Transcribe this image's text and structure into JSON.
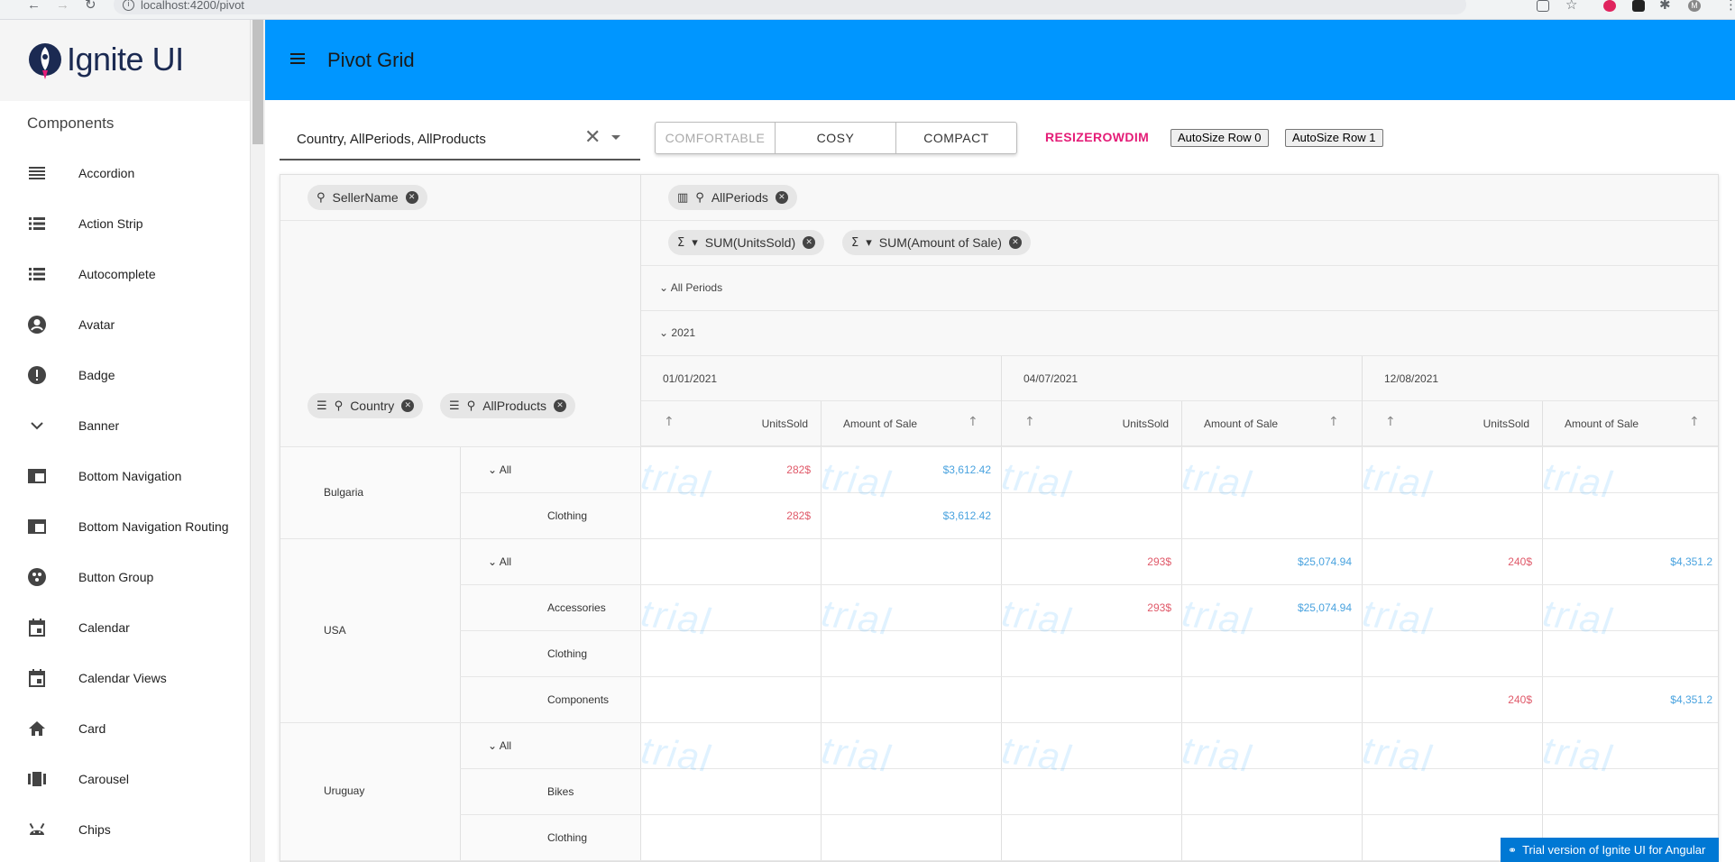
{
  "browser": {
    "url": "localhost:4200/pivot",
    "profile_letter": "M"
  },
  "sidebar": {
    "logo_text": "Ignite UI",
    "heading": "Components",
    "items": [
      {
        "label": "Accordion",
        "icon": "list-icon"
      },
      {
        "label": "Action Strip",
        "icon": "list-icon"
      },
      {
        "label": "Autocomplete",
        "icon": "list-icon"
      },
      {
        "label": "Avatar",
        "icon": "account-circle-icon"
      },
      {
        "label": "Badge",
        "icon": "error-icon"
      },
      {
        "label": "Banner",
        "icon": "chevron-down-icon"
      },
      {
        "label": "Bottom Navigation",
        "icon": "web-icon"
      },
      {
        "label": "Bottom Navigation Routing",
        "icon": "web-icon"
      },
      {
        "label": "Button Group",
        "icon": "group-work-icon"
      },
      {
        "label": "Calendar",
        "icon": "calendar-icon"
      },
      {
        "label": "Calendar Views",
        "icon": "calendar-icon"
      },
      {
        "label": "Card",
        "icon": "home-icon"
      },
      {
        "label": "Carousel",
        "icon": "carousel-icon"
      },
      {
        "label": "Chips",
        "icon": "android-icon"
      }
    ]
  },
  "header": {
    "title": "Pivot Grid"
  },
  "toolbar": {
    "combo_value": "Country, AllPeriods, AllProducts",
    "density": [
      "COMFORTABLE",
      "COSY",
      "COMPACT"
    ],
    "resize_label": "RESIZEROWDIM",
    "autosize0": "AutoSize Row 0",
    "autosize1": "AutoSize Row 1"
  },
  "pivot": {
    "filter_chip": "SellerName",
    "column_chip": "AllPeriods",
    "value_chips": [
      "SUM(UnitsSold)",
      "SUM(Amount of Sale)"
    ],
    "row_chips": [
      "Country",
      "AllProducts"
    ],
    "all_periods": "All Periods",
    "year": "2021",
    "dates": [
      "01/01/2021",
      "04/07/2021",
      "12/08/2021"
    ],
    "measures": [
      "UnitsSold",
      "Amount of Sale"
    ],
    "countries": [
      "Bulgaria",
      "USA",
      "Uruguay"
    ],
    "product_all": "All",
    "products": {
      "bulgaria": [
        "Clothing"
      ],
      "usa": [
        "Accessories",
        "Clothing",
        "Components"
      ],
      "uruguay": [
        "Bikes",
        "Clothing"
      ]
    },
    "values": {
      "r0": [
        "282$",
        "$3,612.42"
      ],
      "r1": [
        "282$",
        "$3,612.42"
      ],
      "r2": [
        "293$",
        "$25,074.94",
        "240$",
        "$4,351.2"
      ],
      "r3": [
        "293$",
        "$25,074.94"
      ],
      "r5": [
        "240$",
        "$4,351.2"
      ]
    },
    "watermark": "trial"
  },
  "trial_banner": "Trial version of Ignite UI for Angular"
}
